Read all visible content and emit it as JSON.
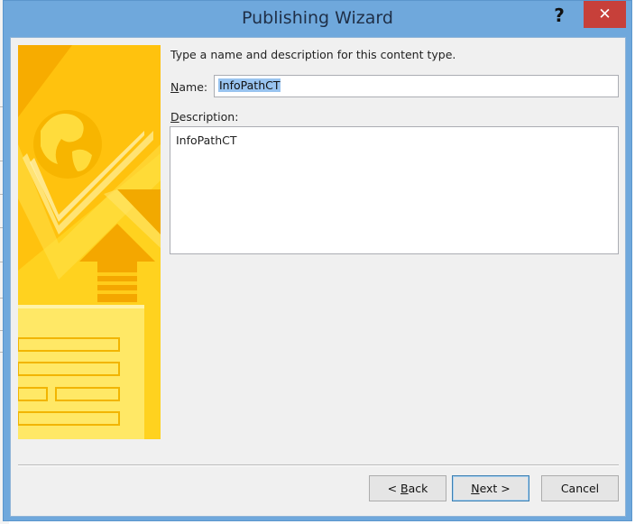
{
  "window": {
    "title": "Publishing Wizard",
    "help_label": "?",
    "close_label": "✕"
  },
  "page": {
    "instruction": "Type a name and description for this content type.",
    "name_label": {
      "mnemonic": "N",
      "rest": "ame:"
    },
    "name_value": "InfoPathCT",
    "description_label": {
      "mnemonic": "D",
      "rest": "escription:"
    },
    "description_value": "InfoPathCT"
  },
  "buttons": {
    "back": {
      "prefix": "< ",
      "mnemonic": "B",
      "rest": "ack"
    },
    "next": {
      "mnemonic": "N",
      "rest": "ext >"
    },
    "cancel": "Cancel"
  },
  "colors": {
    "title_bar": "#6fa8dc",
    "close_button": "#c7403a",
    "banner_yellow": "#ffd21f",
    "banner_orange": "#f5a800",
    "selection": "#99c4f0"
  },
  "icons": {
    "banner": "publishing-banner-graphic",
    "close": "close-icon",
    "help": "help-icon"
  }
}
